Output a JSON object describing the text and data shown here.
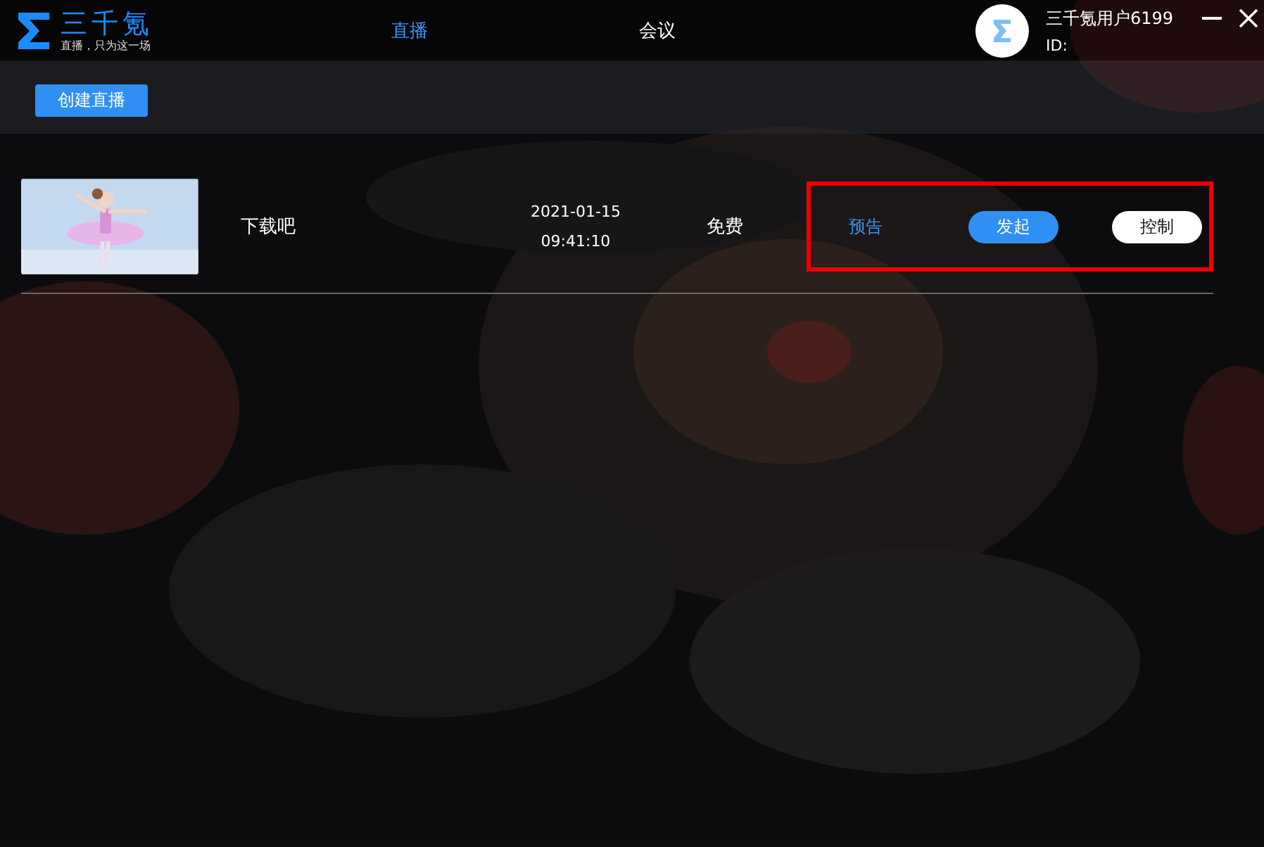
{
  "app": {
    "name": "三千氪",
    "slogan": "直播，只为这一场"
  },
  "nav_tabs": [
    {
      "label": "直播",
      "selected": true
    },
    {
      "label": "会议",
      "selected": false
    }
  ],
  "user": {
    "name": "三千氪用户6199",
    "id_label": "ID:"
  },
  "toolbar": {
    "create_button": "创建直播"
  },
  "streams": [
    {
      "title": "下载吧",
      "date": "2021-01-15",
      "time": "09:41:10",
      "price": "免费",
      "status": "预告",
      "start_button": "发起",
      "control_button": "控制",
      "highlighted": true
    }
  ]
}
